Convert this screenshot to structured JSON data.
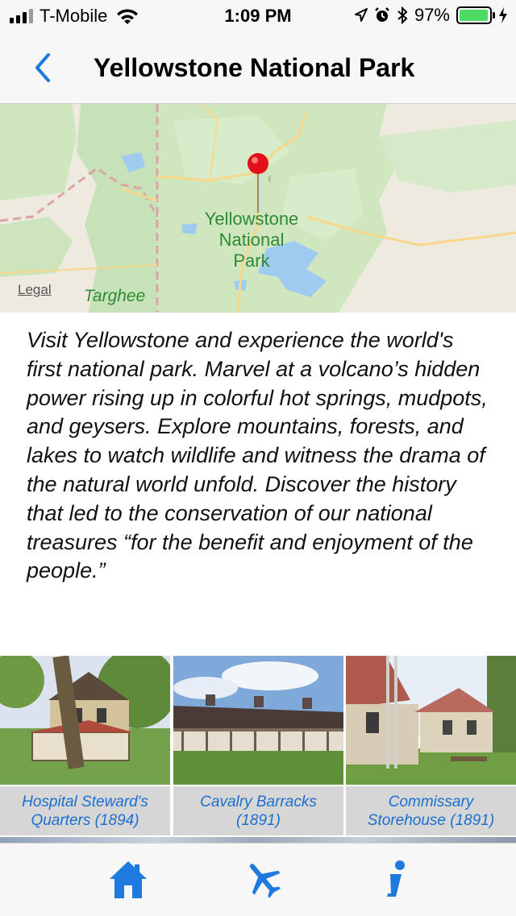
{
  "status_bar": {
    "carrier": "T-Mobile",
    "time": "1:09 PM",
    "battery": "97%",
    "battery_level": 0.97
  },
  "nav": {
    "title": "Yellowstone National Park",
    "back_icon": "chevron-left-icon"
  },
  "map": {
    "park_label": [
      "Yellowstone",
      "National",
      "Park"
    ],
    "legal": "Legal",
    "nearby_label": "Targhee"
  },
  "description": "Visit Yellowstone and experience the world's first national park. Marvel at a volcano’s hidden power rising up in colorful hot springs, mudpots, and geysers. Explore mountains, forests, and lakes to watch wildlife and witness the drama of the natural world unfold. Discover the history that led to the conservation of our national treasures “for the benefit and enjoyment of the people.”",
  "gallery": [
    {
      "title": "Hospital Steward's",
      "year_line": "Quarters  (1894)"
    },
    {
      "title": "Cavalry Barracks",
      "year_line": "(1891)"
    },
    {
      "title": "Commissary",
      "year_line": "Storehouse  (1891)"
    }
  ],
  "tabbar": {
    "items": [
      {
        "icon": "home-icon"
      },
      {
        "icon": "airplane-icon"
      },
      {
        "icon": "info-icon"
      }
    ],
    "accent": "#1f7ae0"
  }
}
